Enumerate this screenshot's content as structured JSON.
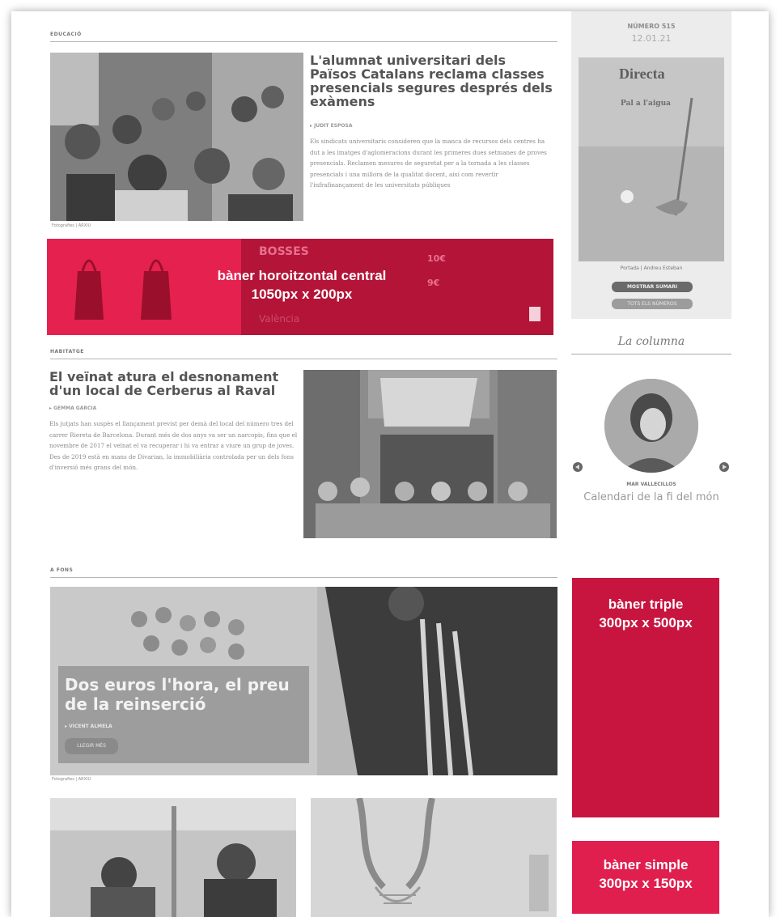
{
  "sections": {
    "education": "EDUCACIÓ",
    "housing": "HABITATGE",
    "deep": "A FONS"
  },
  "article1": {
    "title": "L'alumnat universitari dels Països Catalans reclama classes presencials segures després dels exàmens",
    "author": "▸ JUDIT ESPOSA",
    "body": "Els sindicats universitaris consideren que la manca de recursos dels centres ha dut a les imatges d'aglomeracions durant les primeres dues setmanes de proves presencials. Reclamen mesures de seguretat per a la tornada a les classes presencials i una millora de la qualitat docent, així com revertir l'infrafinançament de les universitats públiques",
    "photo_credit": "Fotografies | ARXIU"
  },
  "banner_central": {
    "line1": "bàner horoitzontal central",
    "line2": "1050px x 200px"
  },
  "article2": {
    "title": "El veïnat atura el desnonament d'un local de Cerberus al Raval",
    "author": "▸ GEMMA GARCIA",
    "body": "Els jutjats han suspès el llançament previst per demà del local del número tres del carrer Riereta de Barcelona. Durant més de dos anys va ser un narcopis, fins que el novembre de 2017 el veïnat el va recuperar i hi va entrar a viure un grup de joves. Des de 2019 està en mans de Divarian, la immobiliària controlada per un dels fons d'inversió més grans del món."
  },
  "article3": {
    "title": "Dos euros l'hora, el preu de la reinserció",
    "author": "▸ VICENT ALMELA",
    "button": "LLEGIR MÉS",
    "photo_credit": "Fotografies | ARXIU"
  },
  "issue": {
    "number": "NÚMERO 515",
    "date": "12.01.21",
    "masthead": "Directa",
    "cover_headline": "Pal a l'aigua",
    "cover_caption": "Portada | Andreu Esteban",
    "btn_summary": "MOSTRAR SUMARI",
    "btn_all": "TOTS ELS NÚMEROS"
  },
  "column": {
    "heading": "La columna",
    "author": "MAR VALLECILLOS",
    "title": "Calendari de la fi del món"
  },
  "banner_triple": {
    "line1": "bàner triple",
    "line2": "300px x 500px"
  },
  "banner_simple": {
    "line1": "bàner simple",
    "line2": "300px x 150px"
  },
  "bag_ad": {
    "headline": "BOSSES",
    "price1": "10€",
    "price2": "9€",
    "city": "València"
  }
}
